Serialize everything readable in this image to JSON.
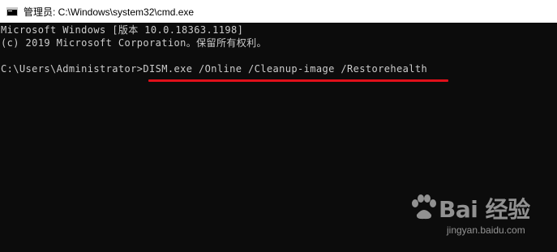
{
  "window": {
    "title": "管理员: C:\\Windows\\system32\\cmd.exe"
  },
  "console": {
    "lines": [
      "Microsoft Windows [版本 10.0.18363.1198]",
      "(c) 2019 Microsoft Corporation。保留所有权利。",
      ""
    ],
    "prompt": "C:\\Users\\Administrator>",
    "command": "DISM.exe /Online /Cleanup-image /Restorehealth"
  },
  "annotation": {
    "color": "#e0101a"
  },
  "watermark": {
    "brand": "Bai 经验",
    "url": "jingyan.baidu.com"
  },
  "colors": {
    "background": "#0c0c0c",
    "text": "#cccccc",
    "titlebar": "#ffffff"
  }
}
